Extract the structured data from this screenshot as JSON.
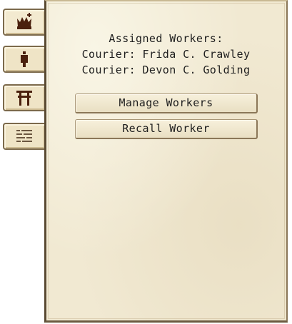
{
  "window": {
    "tabs": [
      {
        "icon": "crown-icon"
      },
      {
        "icon": "bell-icon"
      },
      {
        "icon": "torii-gate-icon"
      },
      {
        "icon": "list-icon"
      }
    ]
  },
  "info": {
    "title": "Assigned Workers:",
    "workers": [
      "Courier: Frida C. Crawley",
      "Courier: Devon C. Golding"
    ]
  },
  "buttons": {
    "manage": "Manage Workers",
    "recall": "Recall Worker"
  },
  "colors": {
    "parchment": "#f1e9d2",
    "border": "#5a4a33",
    "icon": "#5a2a12",
    "text": "#1e1e1e"
  }
}
